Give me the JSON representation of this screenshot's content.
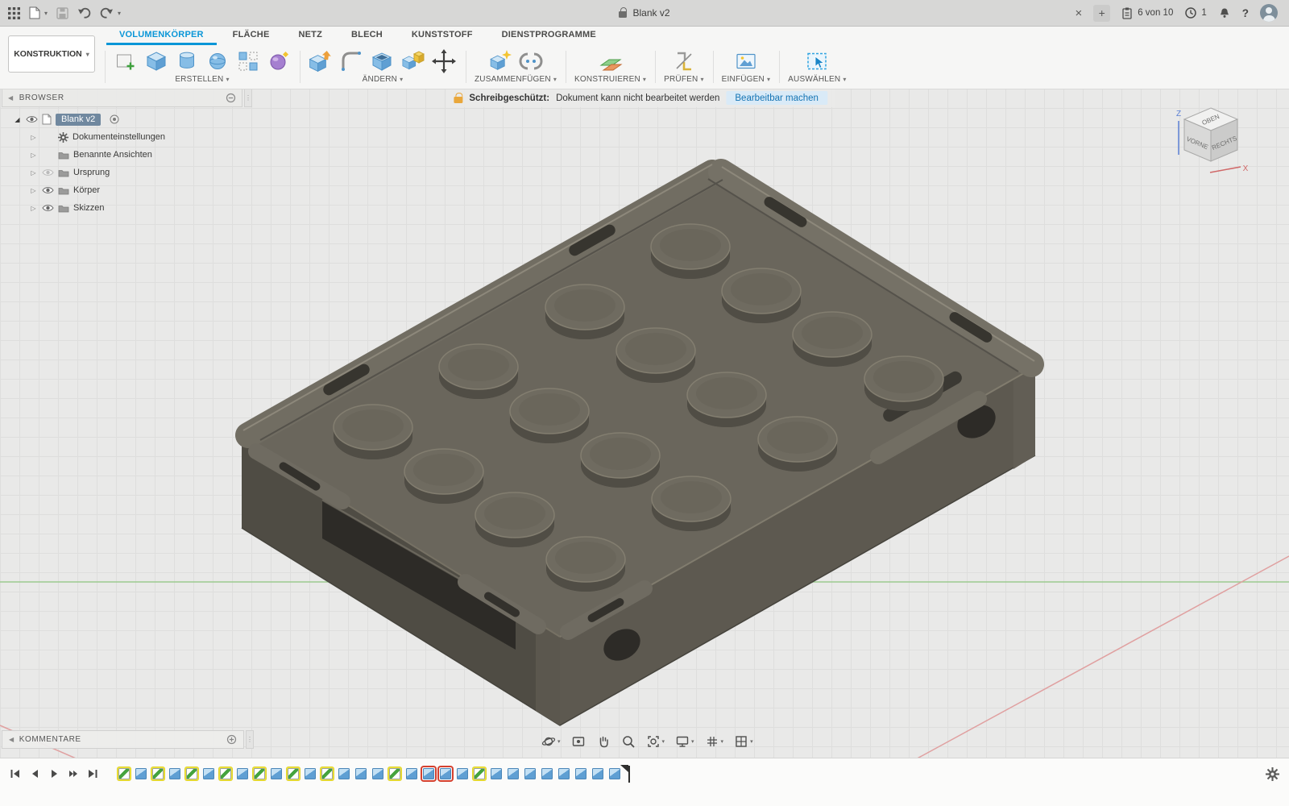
{
  "titlebar": {
    "title": "Blank v2",
    "close": "×",
    "new_tab": "+",
    "job_status": "6 von 10",
    "notifications": "1",
    "help": "?"
  },
  "ribbon": {
    "construction": "KONSTRUKTION",
    "tabs": [
      {
        "label": "VOLUMENKÖRPER",
        "classes": "active"
      },
      {
        "label": "FLÄCHE"
      },
      {
        "label": "NETZ"
      },
      {
        "label": "BLECH"
      },
      {
        "label": "KUNSTSTOFF"
      },
      {
        "label": "DIENSTPROGRAMME"
      }
    ],
    "groups": {
      "erstellen": "ERSTELLEN",
      "aendern": "ÄNDERN",
      "zusammenfuegen": "ZUSAMMENFÜGEN",
      "konstruieren": "KONSTRUIEREN",
      "pruefen": "PRÜFEN",
      "einfuegen": "EINFÜGEN",
      "auswaehlen": "AUSWÄHLEN"
    }
  },
  "warning": {
    "label": "Schreibgeschützt:",
    "message": "Dokument kann nicht bearbeitet werden",
    "action": "Bearbeitbar machen"
  },
  "browser": {
    "header": "BROWSER",
    "root_label": "Blank v2",
    "items": [
      {
        "label": "Dokumenteinstellungen",
        "classes": "icon-gear eye-none"
      },
      {
        "label": "Benannte Ansichten",
        "classes": "icon-folder eye-none"
      },
      {
        "label": "Ursprung",
        "classes": "icon-folder eye-hidden"
      },
      {
        "label": "Körper",
        "classes": "icon-folder eye-visible"
      },
      {
        "label": "Skizzen",
        "classes": "icon-folder eye-visible"
      }
    ]
  },
  "viewcube": {
    "top": "OBEN",
    "front": "VORNE",
    "right": "RECHTS",
    "z": "Z",
    "x": "X"
  },
  "comments": {
    "header": "KOMMENTARE"
  },
  "timeline": {
    "items": [
      {
        "classes": "sketch highlight"
      },
      {
        "classes": "feature"
      },
      {
        "classes": "sketch highlight"
      },
      {
        "classes": "feature"
      },
      {
        "classes": "sketch highlight"
      },
      {
        "classes": "feature"
      },
      {
        "classes": "sketch highlight"
      },
      {
        "classes": "feature"
      },
      {
        "classes": "sketch highlight"
      },
      {
        "classes": "feature"
      },
      {
        "classes": "sketch highlight"
      },
      {
        "classes": "feature"
      },
      {
        "classes": "sketch highlight"
      },
      {
        "classes": "feature"
      },
      {
        "classes": "feature"
      },
      {
        "classes": "feature"
      },
      {
        "classes": "sketch highlight"
      },
      {
        "classes": "feature"
      },
      {
        "classes": "feature error"
      },
      {
        "classes": "feature error"
      },
      {
        "classes": "feature"
      },
      {
        "classes": "sketch highlight"
      },
      {
        "classes": "feature"
      },
      {
        "classes": "feature"
      },
      {
        "classes": "feature"
      },
      {
        "classes": "feature"
      },
      {
        "classes": "feature"
      },
      {
        "classes": "feature"
      },
      {
        "classes": "feature"
      },
      {
        "classes": "feature"
      }
    ]
  },
  "colors": {
    "accent": "#0696d7",
    "model_body": "#6a665c",
    "timeline_highlight": "#f1e637",
    "timeline_error": "#d4402e",
    "selection": "#70889f"
  }
}
